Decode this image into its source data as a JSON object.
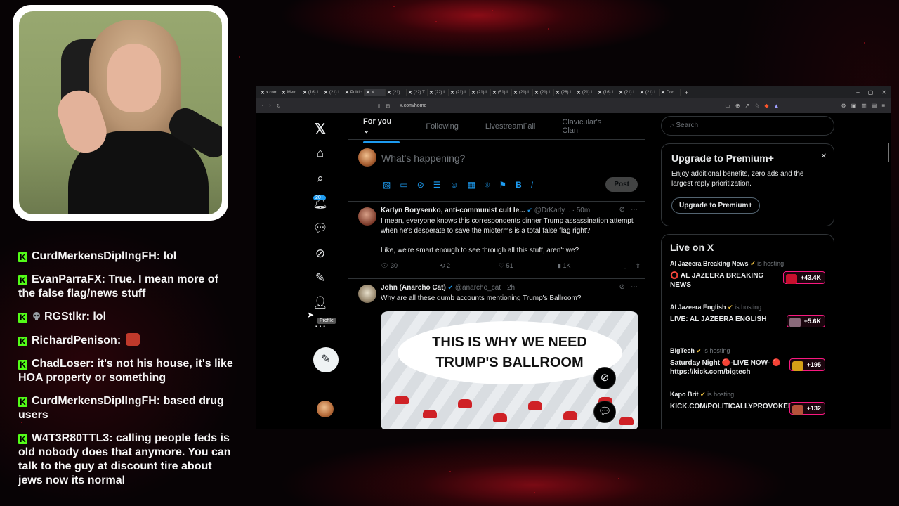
{
  "chat": [
    {
      "user": "CurdMerkensDiplIngFH",
      "text": ": lol",
      "badge": false,
      "emote": false
    },
    {
      "user": "EvanParraFX",
      "text": ": True. I mean more of the false flag/news stuff",
      "badge": false,
      "emote": false
    },
    {
      "user": "RGStlkr",
      "text": ": lol",
      "badge": true,
      "emote": false
    },
    {
      "user": "RichardPenison",
      "text": ":",
      "badge": false,
      "emote": true
    },
    {
      "user": "ChadLoser",
      "text": ": it's not his house, it's like HOA property or something",
      "badge": false,
      "emote": false
    },
    {
      "user": "CurdMerkensDiplIngFH",
      "text": ": based drug users",
      "badge": false,
      "emote": false
    },
    {
      "user": "W4T3R80TTL3",
      "text": ": calling people feds is old nobody does that anymore. You can talk to the guy at discount tire about jews now its normal",
      "badge": false,
      "emote": false
    }
  ],
  "browser": {
    "url": "x.com/home",
    "tabs": [
      "x.com",
      "Mem",
      "(16) I",
      "(21) I",
      "Politic",
      "X",
      "(21)",
      "(22) T",
      "(22) I",
      "(21) I",
      "(21) I",
      "(51) I",
      "(21) I",
      "(21) I",
      "(28) I",
      "(21) I",
      "(16) I",
      "(21) I",
      "(21) I",
      "Doc"
    ]
  },
  "x": {
    "feed_tabs": [
      "For you",
      "Following",
      "LivestreamFail",
      "Clavicular's Clan"
    ],
    "for_you_chevron": "⌄",
    "notif_badge": "20+",
    "tooltip": "Profile",
    "composer_placeholder": "What's happening?",
    "post_label": "Post",
    "search_placeholder": "Search",
    "tweets": [
      {
        "name": "Karlyn Borysenko, anti-communist cult le...",
        "handle": "@DrKarly...",
        "time": "· 50m",
        "body": "I mean, everyone knows this correspondents dinner Trump assassination attempt when he's desperate to save the midterms is a total false flag right?",
        "body2": "Like, we're smart enough to see through all this stuff, aren't we?",
        "replies": "30",
        "reposts": "2",
        "likes": "51",
        "views": "1K"
      },
      {
        "name": "John (Anarcho Cat)",
        "handle": "@anarcho_cat",
        "time": "· 2h",
        "body": "Why are all these dumb accounts mentioning Trump's Ballroom?",
        "image_text_1": "THIS IS WHY WE NEED",
        "image_text_2": "TRUMP'S BALLROOM"
      }
    ],
    "premium": {
      "title": "Upgrade to Premium+",
      "desc": "Enjoy additional benefits, zero ads and the largest reply prioritization.",
      "cta": "Upgrade to Premium+"
    },
    "live": {
      "title": "Live on X",
      "hosting": "is hosting",
      "items": [
        {
          "host": "Al Jazeera Breaking News",
          "title": "⭕ AL JAZEERA BREAKING NEWS",
          "count": "+43.4K",
          "color": "#c8102e"
        },
        {
          "host": "Al Jazeera English",
          "title": "LIVE: AL JAZEERA ENGLISH",
          "count": "+5.6K",
          "color": "#8a6a7a"
        },
        {
          "host": "BigTech",
          "title": "Saturday Night 🔴-LIVE NOW- 🔴 https://kick.com/bigtech",
          "count": "+195",
          "color": "#d4a017"
        },
        {
          "host": "Kapo Brit",
          "title": "KICK.COM/POLITICALLYPROVOKED",
          "count": "+132",
          "color": "#b5523a"
        }
      ]
    }
  }
}
